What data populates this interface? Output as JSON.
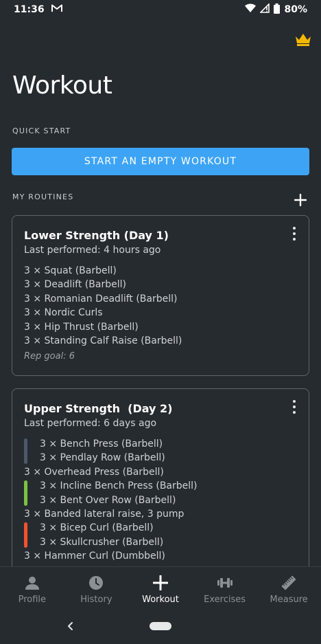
{
  "status_bar": {
    "time": "11:36",
    "battery": "80%",
    "icons": [
      "gmail-icon",
      "wifi-icon",
      "signal-icon",
      "battery-icon"
    ]
  },
  "header": {
    "title": "Workout",
    "premium_icon": "crown-icon"
  },
  "quick_start": {
    "label": "QUICK START",
    "button_label": "START AN EMPTY WORKOUT"
  },
  "routines": {
    "label": "MY ROUTINES",
    "add_icon": "plus-icon",
    "cards": [
      {
        "title": "Lower Strength (Day 1)",
        "last_performed": "Last performed: 4 hours ago",
        "exercises": [
          "3 × Squat (Barbell)",
          "3 × Deadlift (Barbell)",
          "3 × Romanian Deadlift (Barbell)",
          "3 × Nordic Curls",
          "3 × Hip Thrust (Barbell)",
          "3 × Standing Calf Raise (Barbell)"
        ],
        "rep_goal": "Rep goal: 6"
      },
      {
        "title": "Upper Strength  (Day 2)",
        "last_performed": "Last performed: 6 days ago",
        "exercises": [
          "3 × Bench Press (Barbell)",
          "3 × Pendlay Row (Barbell)",
          "3 × Overhead Press (Barbell)",
          "3 × Incline Bench Press (Barbell)",
          "3 × Bent Over Row (Barbell)",
          "3 × Banded lateral raise, 3 pump",
          "3 × Bicep Curl (Barbell)",
          "3 × Skullcrusher (Barbell)",
          "3 × Hammer Curl (Dumbbell)"
        ],
        "superset_colors": [
          "#4a5a6a",
          "#7cc242",
          "#f2522e"
        ]
      }
    ]
  },
  "bottom_nav": {
    "items": [
      {
        "label": "Profile",
        "icon": "person-icon"
      },
      {
        "label": "History",
        "icon": "clock-icon"
      },
      {
        "label": "Workout",
        "icon": "plus-icon",
        "active": true
      },
      {
        "label": "Exercises",
        "icon": "dumbbell-icon"
      },
      {
        "label": "Measure",
        "icon": "ruler-icon"
      }
    ]
  },
  "colors": {
    "background": "#262b30",
    "accent": "#3da4f5",
    "crown": "#f5b800"
  }
}
